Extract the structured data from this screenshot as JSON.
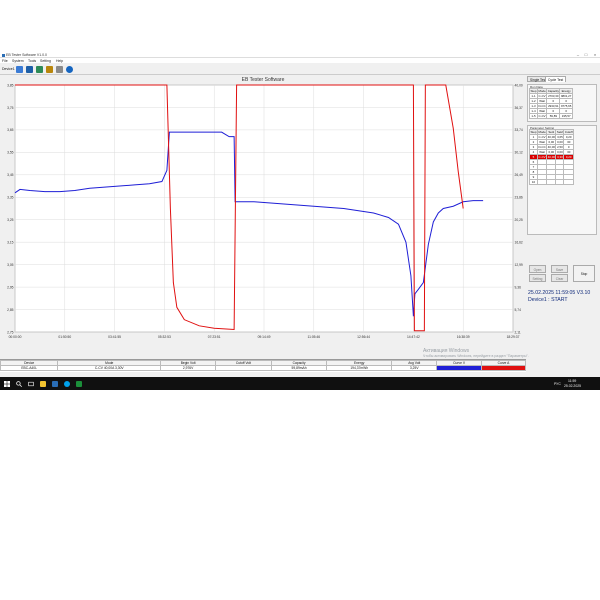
{
  "window": {
    "title": "EB Tester Software V1.0.0",
    "menu": [
      "File",
      "System",
      "Tools",
      "Setting",
      "Help"
    ],
    "device_label": "Device1"
  },
  "chart": {
    "title": "EB Tester Software",
    "left_ticks": [
      "3,85",
      "3,75",
      "3,65",
      "3,55",
      "3,45",
      "3,35",
      "3,25",
      "3,15",
      "3,05",
      "2,95",
      "2,85",
      "2,75"
    ],
    "right_ticks": [
      "40,00",
      "36,37",
      "33,74",
      "30,12",
      "26,49",
      "23,86",
      "20,25",
      "16,62",
      "12,99",
      "9,36",
      "5,74",
      "2,11"
    ],
    "x_ticks": [
      "00:00:00",
      "01:50:50",
      "03:41:55",
      "05:32:53",
      "07:23:51",
      "09:14:49",
      "11:05:46",
      "12:56:44",
      "14:47:42",
      "16:38:39",
      "18:29:37"
    ]
  },
  "chart_data": {
    "type": "line",
    "title": "EB Tester Software",
    "x": [
      "00:00:00",
      "01:50:50",
      "03:41:55",
      "05:32:53",
      "07:23:51",
      "09:14:49",
      "11:05:46",
      "12:56:44",
      "14:47:42",
      "16:38:39",
      "18:29:37"
    ],
    "y_left_range": [
      2.75,
      3.85
    ],
    "y_right_range": [
      0,
      40
    ],
    "grid": true,
    "series": [
      {
        "color": "#1f1fd6",
        "axis": "left",
        "points": [
          [
            0,
            3.37
          ],
          [
            0.1,
            3.385
          ],
          [
            0.3,
            3.38
          ],
          [
            0.6,
            3.375
          ],
          [
            0.9,
            3.375
          ],
          [
            1.2,
            3.38
          ],
          [
            1.5,
            3.39
          ],
          [
            1.8,
            3.395
          ],
          [
            2.1,
            3.4
          ],
          [
            2.4,
            3.405
          ],
          [
            2.7,
            3.41
          ],
          [
            2.95,
            3.42
          ],
          [
            3.05,
            3.47
          ],
          [
            3.1,
            3.64
          ],
          [
            3.3,
            3.64
          ],
          [
            3.6,
            3.64
          ],
          [
            3.9,
            3.64
          ],
          [
            4.15,
            3.64
          ],
          [
            4.3,
            3.62
          ],
          [
            4.4,
            3.62
          ],
          [
            4.42,
            3.33
          ],
          [
            4.5,
            3.33
          ],
          [
            4.8,
            3.33
          ],
          [
            5.1,
            3.325
          ],
          [
            5.4,
            3.32
          ],
          [
            5.7,
            3.315
          ],
          [
            6.0,
            3.31
          ],
          [
            6.3,
            3.305
          ],
          [
            6.6,
            3.3
          ],
          [
            6.9,
            3.29
          ],
          [
            7.2,
            3.28
          ],
          [
            7.5,
            3.26
          ],
          [
            7.7,
            3.23
          ],
          [
            7.85,
            3.15
          ],
          [
            7.95,
            3.0
          ],
          [
            8.0,
            2.82
          ],
          [
            8.03,
            2.92
          ],
          [
            8.1,
            2.94
          ],
          [
            8.2,
            2.97
          ],
          [
            8.3,
            3.14
          ],
          [
            8.4,
            3.24
          ],
          [
            8.5,
            3.28
          ],
          [
            8.6,
            3.3
          ],
          [
            8.8,
            3.31
          ],
          [
            9.0,
            3.33
          ],
          [
            9.2,
            3.335
          ],
          [
            9.4,
            3.335
          ]
        ]
      },
      {
        "color": "#e01010",
        "axis": "right",
        "points": [
          [
            0,
            40.0
          ],
          [
            3.0,
            40.0
          ],
          [
            3.05,
            40.0
          ],
          [
            3.12,
            20.0
          ],
          [
            3.18,
            8.0
          ],
          [
            3.25,
            4.0
          ],
          [
            3.4,
            2.0
          ],
          [
            3.7,
            1.0
          ],
          [
            4.0,
            0.6
          ],
          [
            4.4,
            0.4
          ],
          [
            4.45,
            40.0
          ],
          [
            8.0,
            40.0
          ],
          [
            8.02,
            0.2
          ],
          [
            8.22,
            0.2
          ],
          [
            8.24,
            40.0
          ],
          [
            8.65,
            40.0
          ],
          [
            8.8,
            33.0
          ],
          [
            8.9,
            26.0
          ],
          [
            9.0,
            20.0
          ]
        ]
      }
    ]
  },
  "panel": {
    "tabs": [
      "Single Test",
      "Cycle Test"
    ],
    "run_data_title": "Run Data",
    "run_data_headers": [
      "Step",
      "Mode",
      "Capacity",
      "Energy"
    ],
    "run_data": [
      [
        "1-1",
        "C-CV",
        "2703,30",
        "9801,27"
      ],
      [
        "1-2",
        "Wait",
        "0",
        "0"
      ],
      [
        "1-3",
        "D-CC",
        "2933,91",
        "9775,65"
      ],
      [
        "1-4",
        "Wait",
        "0",
        "0"
      ],
      [
        "1-5",
        "C-CV",
        "59,89",
        "195,57"
      ]
    ],
    "param_title": "Parameter Setting",
    "param_headers": [
      "Step",
      "Mode",
      "Set1",
      "Set2",
      "Cutoff"
    ],
    "param_rows": [
      [
        "1",
        "C-CV",
        "40,00",
        "3,65",
        "0,20"
      ],
      [
        "2",
        "Wait",
        "0,00",
        "0,00",
        "30"
      ],
      [
        "3",
        "D-CC",
        "40,00",
        "2,50",
        "0"
      ],
      [
        "4",
        "Wait",
        "0,00",
        "0,00",
        "30"
      ],
      [
        "5",
        "C-CV",
        "40,00",
        "3,30",
        "0,20"
      ],
      [
        "6",
        "",
        "",
        "",
        ""
      ],
      [
        "7",
        "",
        "",
        "",
        ""
      ],
      [
        "8",
        "",
        "",
        "",
        ""
      ],
      [
        "9",
        "",
        "",
        "",
        ""
      ],
      [
        "10",
        "",
        "",
        "",
        ""
      ]
    ],
    "buttons": {
      "open": "Open",
      "save": "Save",
      "setting": "Setting",
      "clear": "Clear",
      "stop": "Stop"
    },
    "status_time": "25.02.2025 11:59:05  V3.10",
    "status_device": "Device1 : START"
  },
  "info": {
    "headers": [
      "Device",
      "Mode",
      "Begin Volt",
      "Cutoff Volt",
      "Capacity",
      "Energy",
      "Avg Volt",
      "Curve V",
      "Curve A"
    ],
    "values": [
      "EBC-A40L",
      "C-CV   40,00A  3,30V",
      "2,976V",
      "",
      "59,89mAh",
      "194,37mWh",
      "3,25V",
      "",
      ""
    ]
  },
  "watermark": {
    "line1": "Активация Windows",
    "line2": "Чтобы активировать Windows, перейдите в раздел \"Параметры\"."
  },
  "taskbar": {
    "lang": "РУС",
    "time": "11:59",
    "date": "25.02.2025"
  },
  "colors": {
    "voltage": "#1f1fd6",
    "current": "#e01010",
    "taskbar": "#101010",
    "status": "#102a7a"
  }
}
